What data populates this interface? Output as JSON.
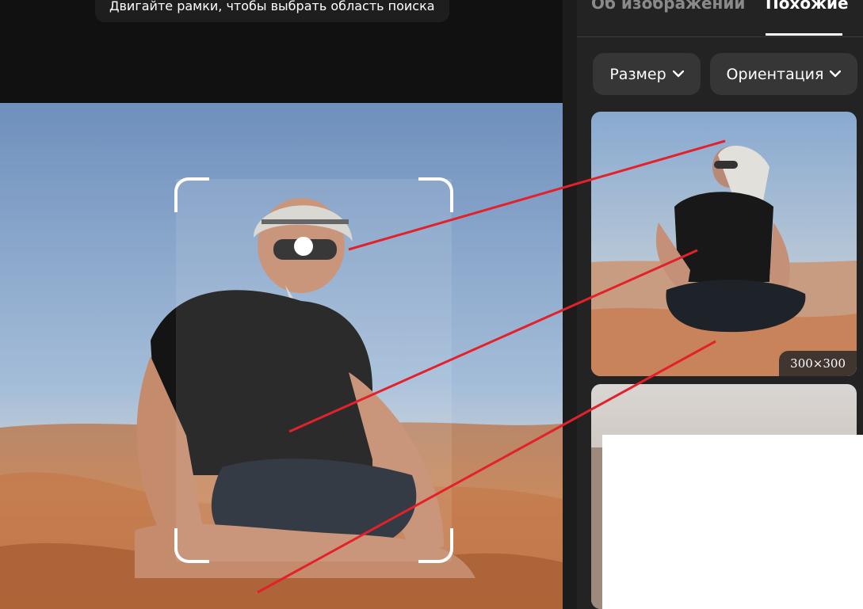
{
  "viewer": {
    "hint_text": "Двигайте рамки, чтобы выбрать область поиска"
  },
  "panel": {
    "tabs": [
      {
        "label": "Об изображении",
        "active": false
      },
      {
        "label": "Похожие",
        "active": true
      }
    ],
    "filters": [
      {
        "label": "Размер"
      },
      {
        "label": "Ориентация"
      }
    ],
    "results": [
      {
        "dimensions": "300×300"
      },
      {
        "dimensions": ""
      }
    ]
  },
  "colors": {
    "accent_line": "#e3212b",
    "panel_bg": "#232323",
    "chip_bg": "#363636"
  }
}
